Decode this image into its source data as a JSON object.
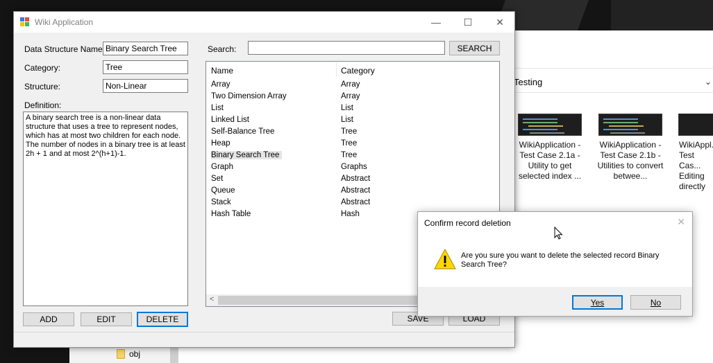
{
  "window": {
    "title": "Wiki Application",
    "minimize": "—",
    "maximize": "☐",
    "close": "✕"
  },
  "form": {
    "name_label": "Data Structure Name:",
    "name_value": "Binary Search Tree",
    "category_label": "Category:",
    "category_value": "Tree",
    "structure_label": "Structure:",
    "structure_value": "Non-Linear",
    "definition_label": "Definition:",
    "definition_value": "A binary search tree is a non-linear data structure that uses a tree to represent nodes, which has at most two children for each node. The number of nodes in a binary tree is at least 2h + 1 and at most 2^(h+1)-1."
  },
  "buttons": {
    "add": "ADD",
    "edit": "EDIT",
    "delete": "DELETE",
    "save": "SAVE",
    "load": "LOAD",
    "search": "SEARCH"
  },
  "search": {
    "label": "Search:",
    "value": ""
  },
  "list": {
    "columns": [
      "Name",
      "Category"
    ],
    "rows": [
      [
        "Array",
        "Array"
      ],
      [
        "Two Dimension Array",
        "Array"
      ],
      [
        "List",
        "List"
      ],
      [
        "Linked List",
        "List"
      ],
      [
        "Self-Balance Tree",
        "Tree"
      ],
      [
        "Heap",
        "Tree"
      ],
      [
        "Binary Search Tree",
        "Tree"
      ],
      [
        "Graph",
        "Graphs"
      ],
      [
        "Set",
        "Abstract"
      ],
      [
        "Queue",
        "Abstract"
      ],
      [
        "Stack",
        "Abstract"
      ],
      [
        "Hash Table",
        "Hash"
      ]
    ],
    "selected_index": 6
  },
  "dialog": {
    "title": "Confirm record deletion",
    "message": "Are you sure you want to delete the selected record Binary Search Tree?",
    "yes_label": "Yes",
    "no_label": "No",
    "close": "✕"
  },
  "explorer": {
    "path_text": "Testing",
    "folder_label": "obj",
    "files": [
      "WikiApplication - Test Case 2.1a - Utility to get selected index ...",
      "WikiApplication - Test Case 2.1b - Utilities to convert betwee...",
      "WikiAppl... Test Cas... Editing directly"
    ]
  },
  "colors": {
    "accent": "#0078d7",
    "window_bg": "#f0f0f0",
    "warning": "#ffd800"
  }
}
